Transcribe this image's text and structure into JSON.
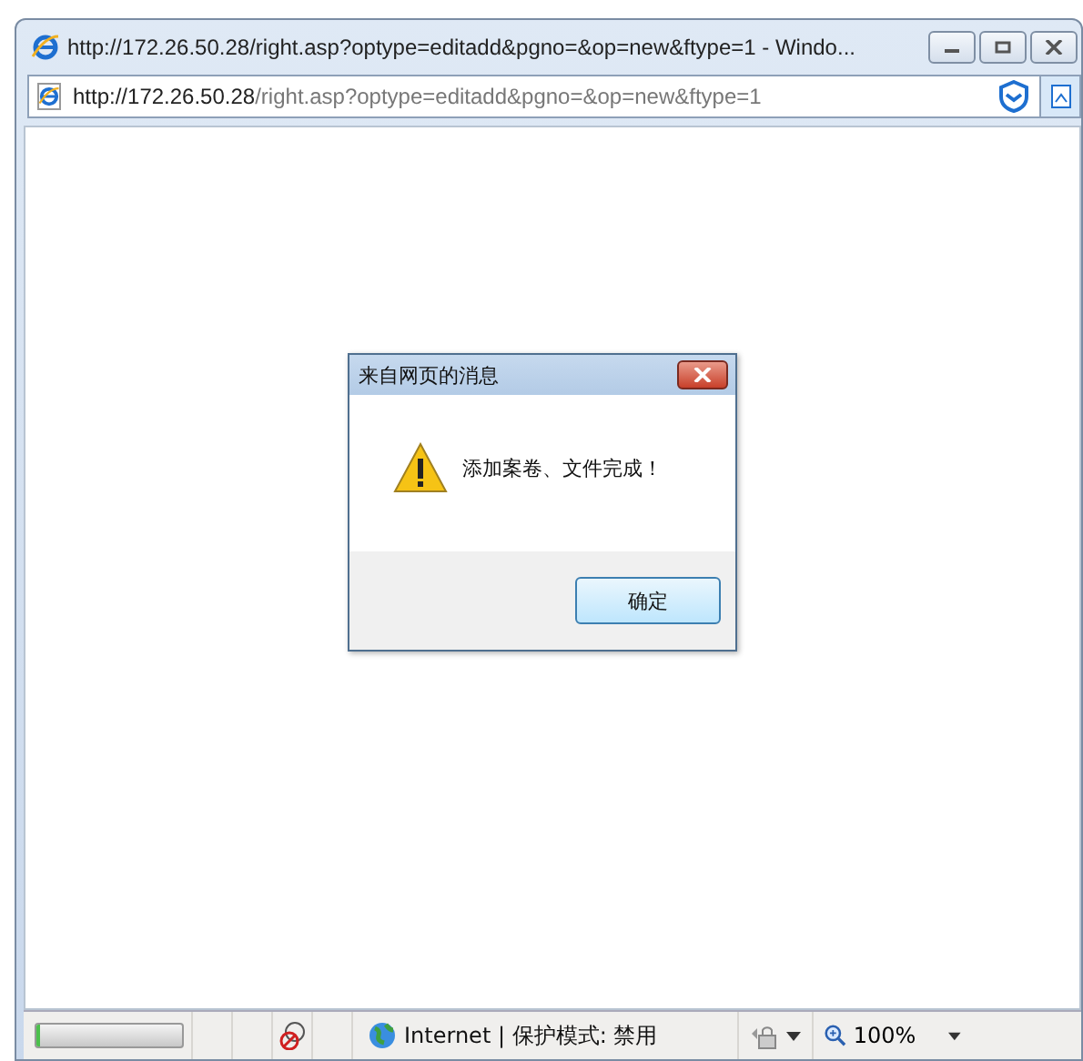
{
  "window": {
    "title": "http://172.26.50.28/right.asp?optype=editadd&pgno=&op=new&ftype=1 - Windo..."
  },
  "address_bar": {
    "host": "http://172.26.50.28",
    "path": "/right.asp?optype=editadd&pgno=&op=new&ftype=1"
  },
  "dialog": {
    "title": "来自网页的消息",
    "message": "添加案卷、文件完成！",
    "button": "确定"
  },
  "status_bar": {
    "progress": {
      "level": 0.02
    },
    "zone": "Internet | 保护模式: 禁用",
    "zoom": "100%"
  }
}
